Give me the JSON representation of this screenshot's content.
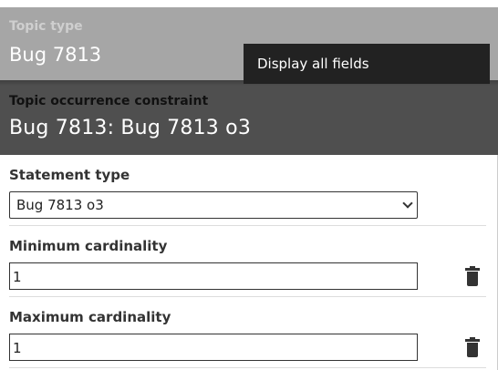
{
  "topic": {
    "label": "Topic type",
    "value": "Bug 7813"
  },
  "menu": {
    "display_all_fields": "Display all fields"
  },
  "constraint": {
    "label": "Topic occurrence constraint",
    "value": "Bug 7813: Bug 7813 o3"
  },
  "fields": {
    "statement_type": {
      "label": "Statement type",
      "selected": "Bug 7813 o3"
    },
    "min_cardinality": {
      "label": "Minimum cardinality",
      "value": "1"
    },
    "max_cardinality": {
      "label": "Maximum cardinality",
      "value": "1"
    }
  },
  "icons": {
    "delete": "trash-icon",
    "dropdown": "chevron-down-icon"
  },
  "colors": {
    "topic_panel": "#a6a6a6",
    "constraint_panel": "#4f4f4f",
    "popup_menu": "#222222"
  }
}
